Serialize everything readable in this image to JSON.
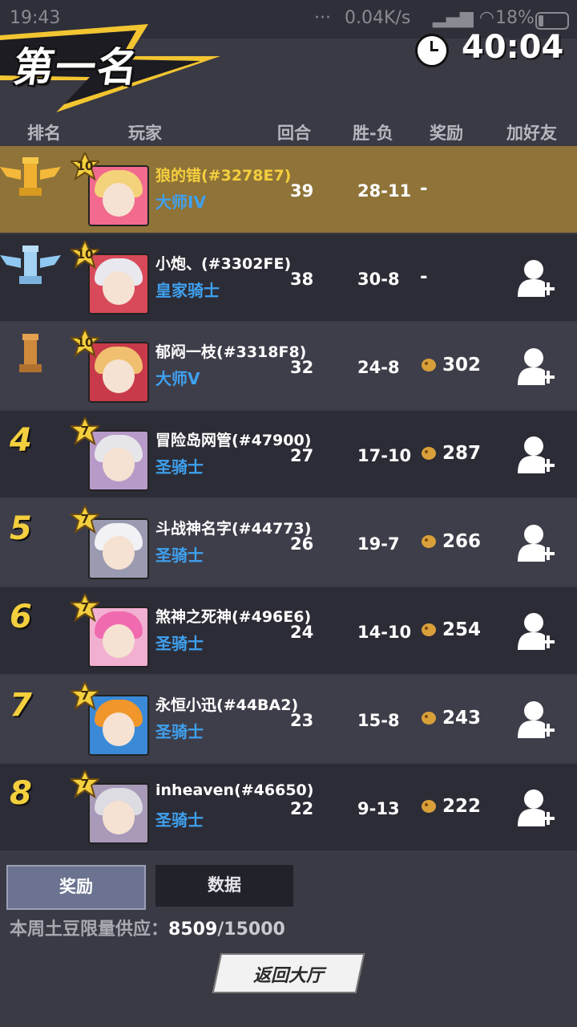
{
  "statusbar": {
    "time": "19:43",
    "dots": "···",
    "speed": "0.04K/s",
    "battery": "18%"
  },
  "banner": {
    "title": "第一名"
  },
  "timer": {
    "value": "40:04"
  },
  "header": {
    "rank": "排名",
    "player": "玩家",
    "rounds": "回合",
    "winloss": "胜-负",
    "reward": "奖励",
    "add_friend": "加好友"
  },
  "rows": [
    {
      "rank": "1",
      "level": "10",
      "name": "狼的错(#3278E7)",
      "title": "大师IV",
      "rounds": "39",
      "wl": "28-11",
      "reward": "-"
    },
    {
      "rank": "2",
      "level": "10",
      "name": "小炮、(#3302FE)",
      "title": "皇家骑士",
      "rounds": "38",
      "wl": "30-8",
      "reward": "-"
    },
    {
      "rank": "3",
      "level": "10",
      "name": "郁闷一枝(#3318F8)",
      "title": "大师V",
      "rounds": "32",
      "wl": "24-8",
      "reward": "302"
    },
    {
      "rank": "4",
      "level": "7",
      "name": "冒险岛网管(#47900)",
      "title": "圣骑士",
      "rounds": "27",
      "wl": "17-10",
      "reward": "287"
    },
    {
      "rank": "5",
      "level": "7",
      "name": "斗战神名字(#44773)",
      "title": "圣骑士",
      "rounds": "26",
      "wl": "19-7",
      "reward": "266"
    },
    {
      "rank": "6",
      "level": "7",
      "name": "煞神之死神(#496E6)",
      "title": "圣骑士",
      "rounds": "24",
      "wl": "14-10",
      "reward": "254"
    },
    {
      "rank": "7",
      "level": "7",
      "name": "永恒小迅(#44BA2)",
      "title": "圣骑士",
      "rounds": "23",
      "wl": "15-8",
      "reward": "243"
    },
    {
      "rank": "8",
      "level": "7",
      "name": "inheaven(#46650)",
      "title": "圣骑士",
      "rounds": "22",
      "wl": "9-13",
      "reward": "222"
    }
  ],
  "tabs": {
    "rewards": "奖励",
    "stats": "数据"
  },
  "supply": {
    "label": "本周土豆限量供应：",
    "current": "8509",
    "max": "/15000"
  },
  "back_button": {
    "label": "返回大厅"
  },
  "colors": {
    "gold": "#f4cf3e",
    "title_blue": "#3fa1f0",
    "highlight_row": "#8f7338"
  }
}
